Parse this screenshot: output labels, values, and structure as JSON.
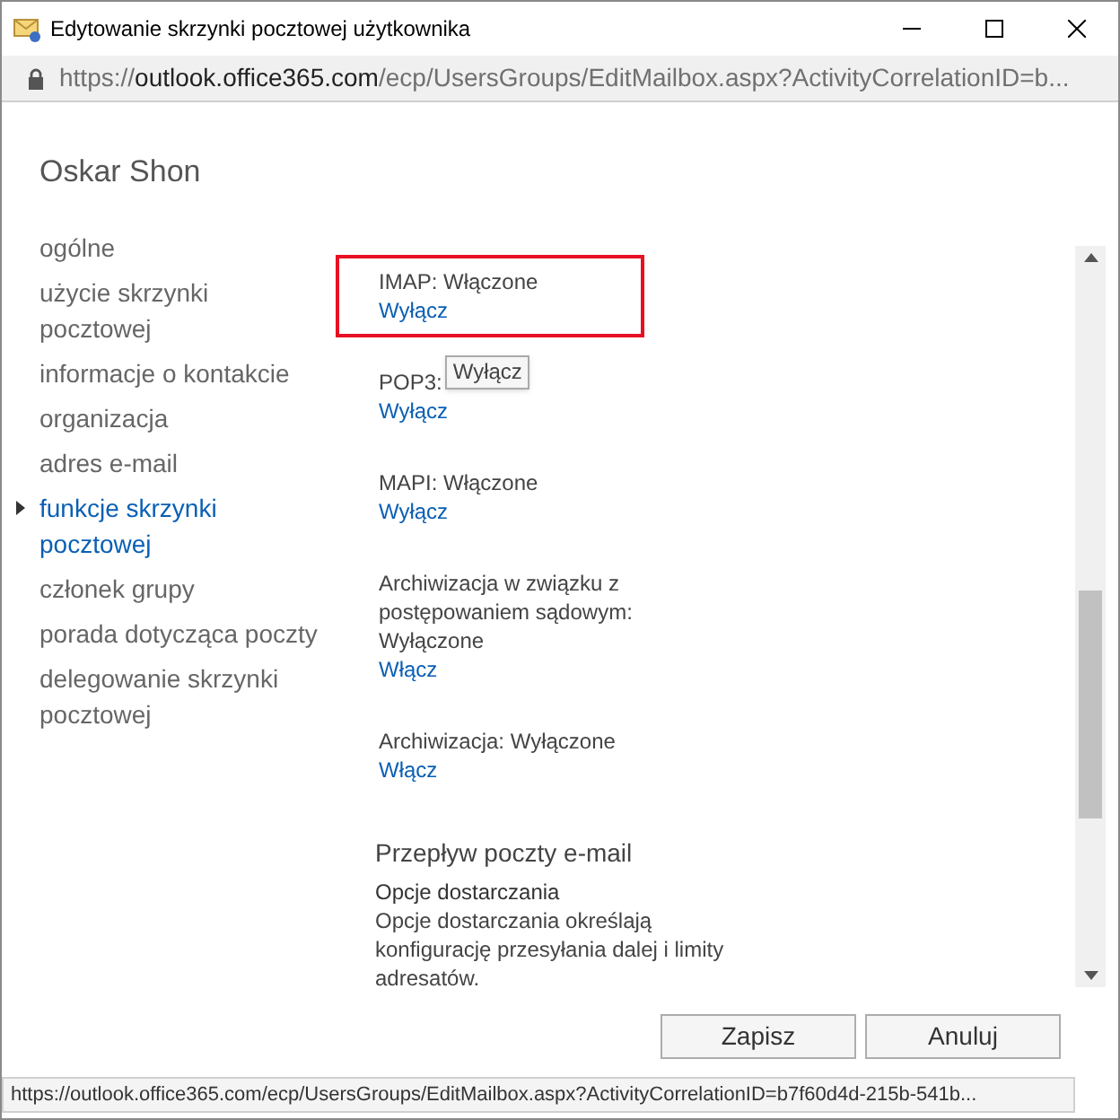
{
  "window": {
    "title": "Edytowanie skrzynki pocztowej użytkownika"
  },
  "address_bar": {
    "scheme": "https://",
    "domain": "outlook.office365.com",
    "path": "/ecp/UsersGroups/EditMailbox.aspx?ActivityCorrelationID=b..."
  },
  "heading": "Oskar Shon",
  "nav": [
    {
      "label": "ogólne",
      "selected": false
    },
    {
      "label": "użycie skrzynki pocztowej",
      "selected": false
    },
    {
      "label": "informacje o kontakcie",
      "selected": false
    },
    {
      "label": "organizacja",
      "selected": false
    },
    {
      "label": "adres e-mail",
      "selected": false
    },
    {
      "label": "funkcje skrzynki pocztowej",
      "selected": true
    },
    {
      "label": "członek grupy",
      "selected": false
    },
    {
      "label": "porada dotycząca poczty",
      "selected": false
    },
    {
      "label": "delegowanie skrzynki pocztowej",
      "selected": false
    }
  ],
  "features": [
    {
      "status": "IMAP: Włączone",
      "action": "Wyłącz",
      "highlighted": true
    },
    {
      "status": "POP3:",
      "action": "Wyłącz",
      "highlighted": false,
      "tooltip": "Wyłącz"
    },
    {
      "status": "MAPI: Włączone",
      "action": "Wyłącz",
      "highlighted": false
    },
    {
      "status": "Archiwizacja w związku z postępowaniem sądowym: Wyłączone",
      "action": "Włącz",
      "highlighted": false
    },
    {
      "status": "Archiwizacja: Wyłączone",
      "action": "Włącz",
      "highlighted": false
    }
  ],
  "mail_flow": {
    "title": "Przepływ poczty e-mail",
    "subtitle": "Opcje dostarczania",
    "description": "Opcje dostarczania określają konfigurację przesyłania dalej i limity adresatów."
  },
  "buttons": [
    "Zapisz",
    "Anuluj"
  ],
  "status_bar": "https://outlook.office365.com/ecp/UsersGroups/EditMailbox.aspx?ActivityCorrelationID=b7f60d4d-215b-541b..."
}
